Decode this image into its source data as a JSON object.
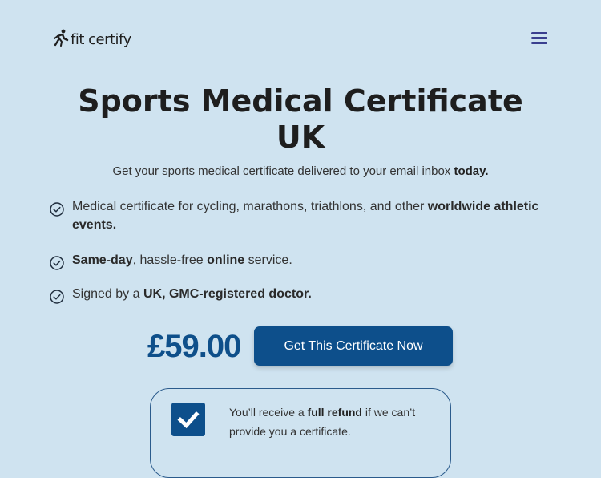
{
  "header": {
    "logo_text": "fit certify",
    "logo_icon": "runner-logo-icon",
    "menu_icon": "hamburger-menu-icon"
  },
  "hero": {
    "title_line1": "Sports Medical Certificate",
    "title_line2": "UK",
    "subtitle_prefix": "Get your sports medical certificate delivered to your email inbox ",
    "subtitle_bold": "today."
  },
  "features": [
    {
      "icon": "check-circle-icon",
      "parts": [
        "Medical certificate for cycling, marathons, triathlons, and other ",
        "worldwide athletic events."
      ]
    },
    {
      "icon": "check-circle-icon",
      "parts": [
        "Same-day",
        ", hassle-free ",
        "online",
        " service."
      ]
    },
    {
      "icon": "check-circle-icon",
      "parts": [
        "Signed by a ",
        "UK, GMC-registered doctor."
      ]
    }
  ],
  "pricing": {
    "price": "£59.00",
    "cta_label": "Get This Certificate Now"
  },
  "refund": {
    "text_prefix": "You’ll receive a ",
    "text_bold": "full refund",
    "text_suffix": " if we can’t provide you a certificate."
  },
  "colors": {
    "background": "#cfe3f0",
    "brand_blue": "#0d4f8b",
    "menu_icon": "#3a3f8f",
    "text": "#2b2b2b"
  }
}
